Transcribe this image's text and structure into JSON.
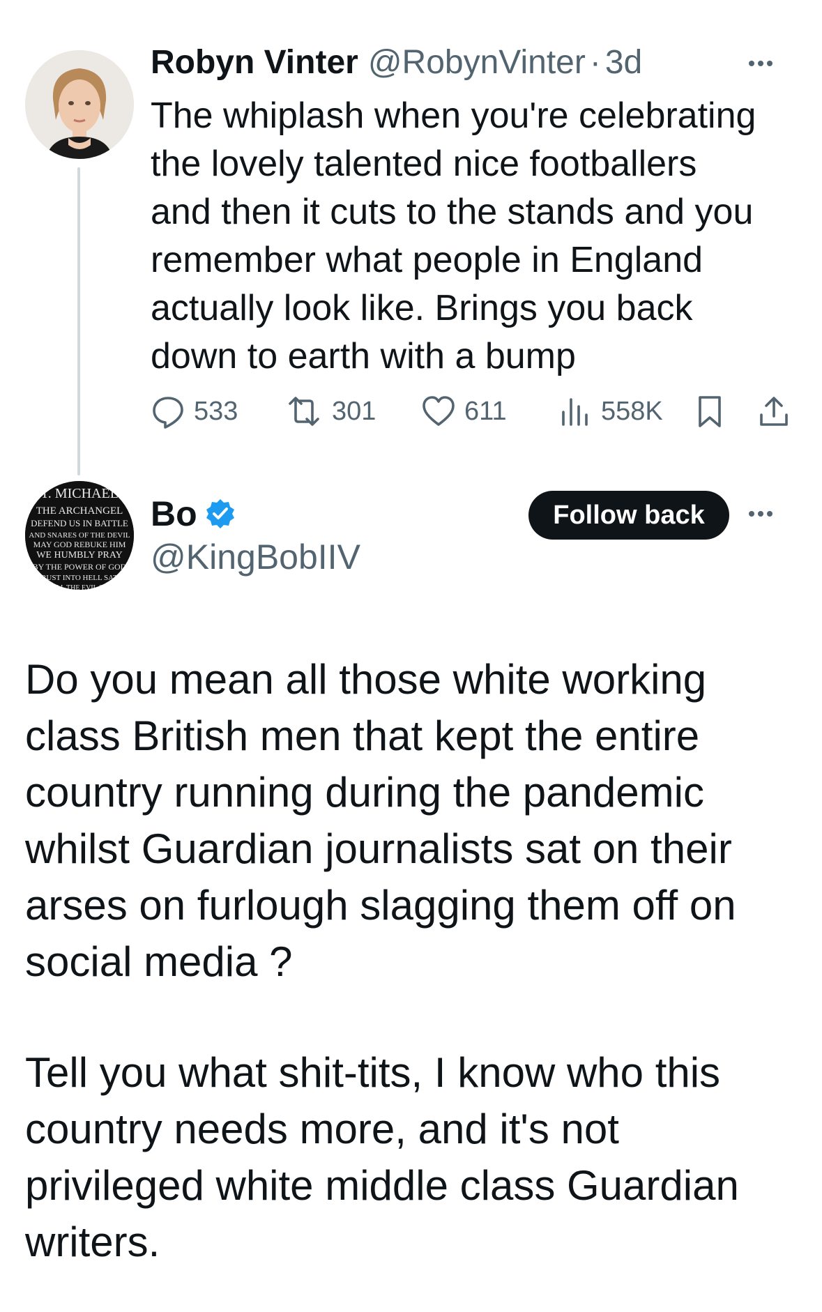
{
  "original_tweet": {
    "author_name": "Robyn Vinter",
    "handle": "@RobynVinter",
    "separator": "·",
    "time": "3d",
    "text_lines": [
      "The whiplash when you're celebrating",
      "the lovely talented nice footballers",
      "and then it cuts to the stands and you",
      "remember what people in England",
      "actually look like. Brings you back",
      "down to earth with a bump"
    ],
    "stats": {
      "replies": "533",
      "retweets": "301",
      "likes": "611",
      "views": "558K"
    },
    "icons": {
      "reply": "reply-icon",
      "retweet": "retweet-icon",
      "like": "heart-icon",
      "views": "views-icon",
      "bookmark": "bookmark-icon",
      "share": "share-icon",
      "more": "more-icon"
    }
  },
  "reply_tweet": {
    "author_name": "Bo",
    "handle": "@KingBobIIV",
    "verified": true,
    "follow_label": "Follow back",
    "avatar_text_lines": [
      "T. MICHAEL",
      "THE ARCHANGEL",
      "DEFEND US IN BATTLE",
      "AND SNARES OF THE DEVIL",
      "MAY GOD REBUKE HIM",
      "WE HUMBLY PRAY",
      "BY THE POWER OF GOD",
      "THRUST INTO HELL SATAN",
      "AND ALL THE EVIL SPIRITS"
    ],
    "paragraph1_lines": [
      "Do you mean all those white working",
      "class British men that kept the entire",
      "country running during the pandemic",
      "whilst Guardian journalists sat on their",
      "arses on furlough slagging them off on",
      "social media ?"
    ],
    "paragraph2_lines": [
      "Tell you what shit-tits, I know who this",
      "country needs more, and it's not",
      "privileged white middle class Guardian",
      "writers."
    ]
  },
  "colors": {
    "text": "#0f1419",
    "secondary": "#536471",
    "thread_line": "#cfd9de",
    "verified_blue": "#1d9bf0",
    "button_bg": "#0f1419"
  }
}
